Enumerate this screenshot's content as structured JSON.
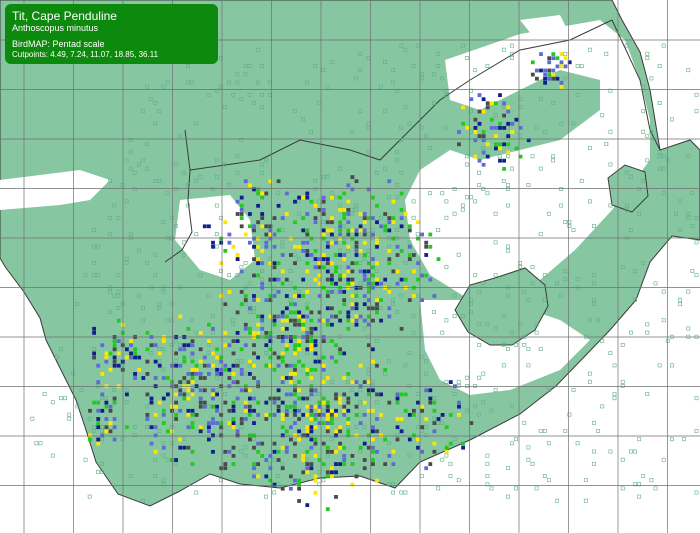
{
  "legend": {
    "common_name": "Tit, Cape Penduline",
    "scientific_name": "Anthoscopus minutus",
    "scale_label": "BirdMAP: Pentad scale",
    "cutpoints_label": "Cutpoints: 4.49, 7.24, 11.07, 18.85, 36.11"
  },
  "map": {
    "colors": {
      "ocean": "#ffffff",
      "land": "#86c7a2",
      "coverage_ring": "#5fae85",
      "grid": "#6f6f6f",
      "border": "#3a3a3a",
      "unsurveyed": "#ffffff"
    },
    "reporting_rate_classes": [
      {
        "name": "lowest",
        "color": "#ffe600"
      },
      {
        "name": "low",
        "color": "#23c823"
      },
      {
        "name": "mid",
        "color": "#5c6bd6"
      },
      {
        "name": "high",
        "color": "#101f8a"
      },
      {
        "name": "highest",
        "color": "#4a4a4a"
      }
    ]
  }
}
